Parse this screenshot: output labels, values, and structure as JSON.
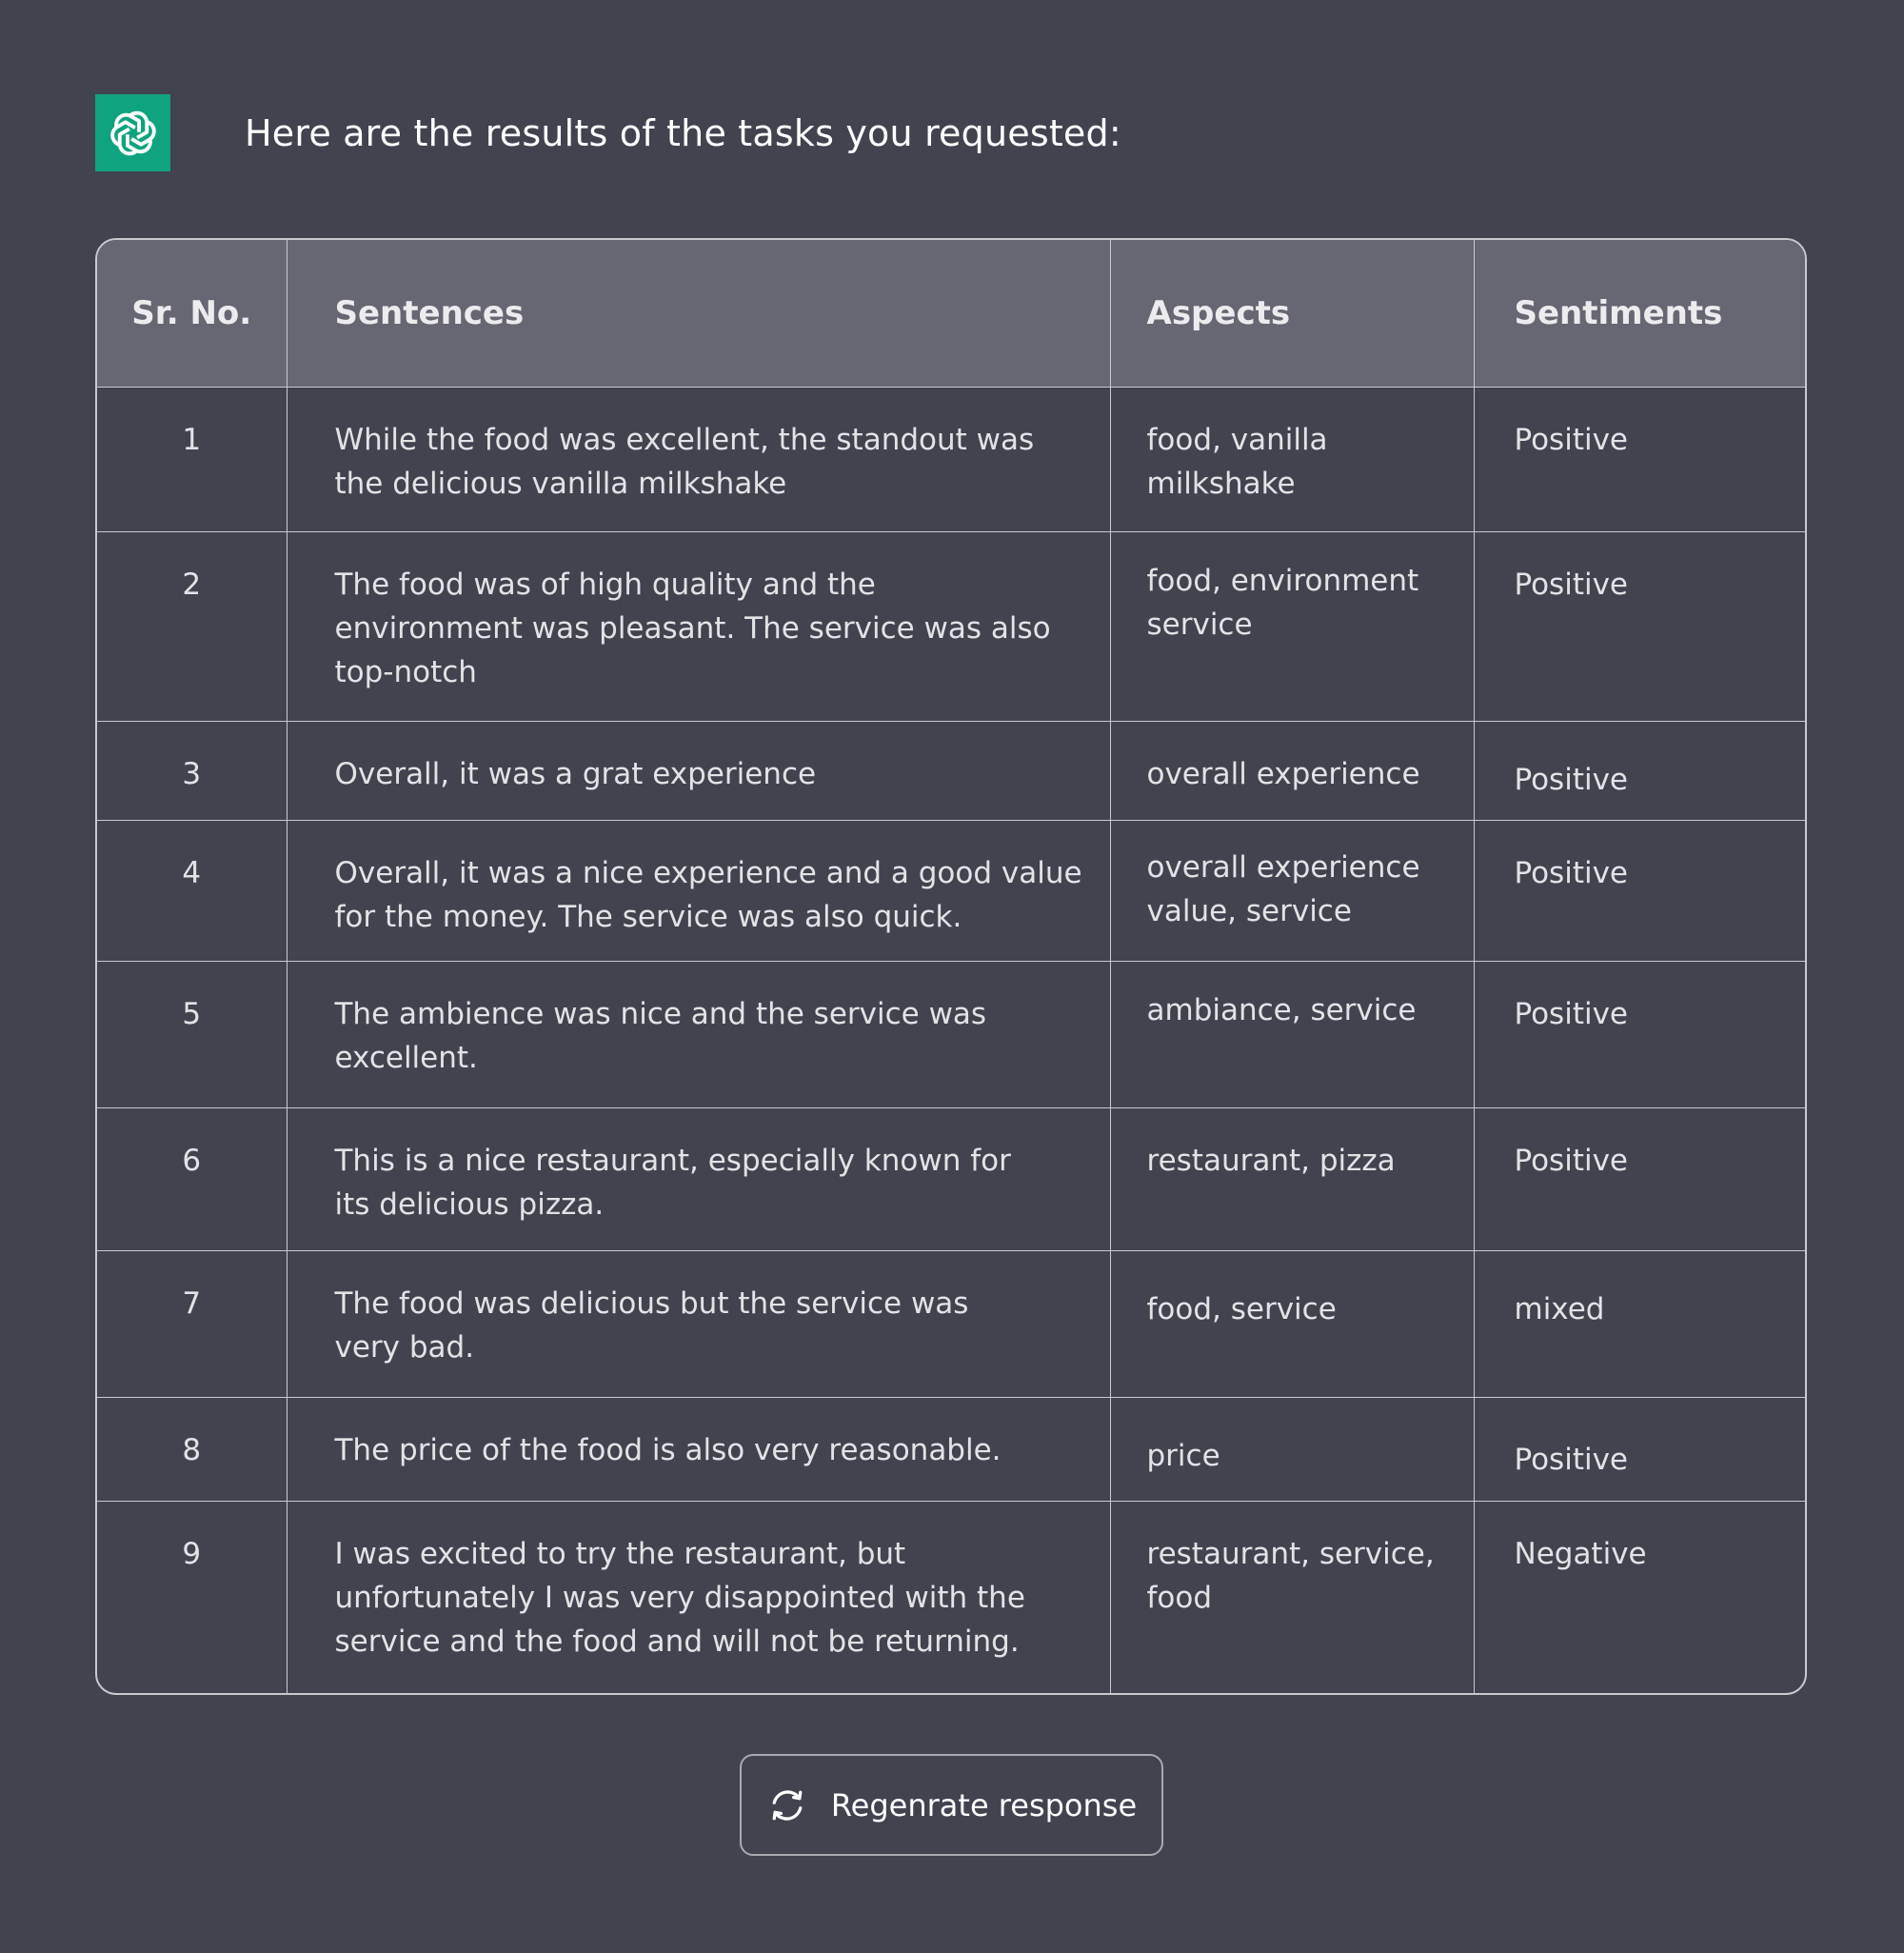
{
  "header": {
    "logo_icon": "openai-logo-icon",
    "title": "Here are the results of the tasks you requested:"
  },
  "colors": {
    "background": "#41434f",
    "header_row": "#676773",
    "logo_bg": "#10a37f",
    "border": "#c9c9ce"
  },
  "table": {
    "columns": [
      "Sr. No.",
      "Sentences",
      "Aspects",
      "Sentiments"
    ],
    "rows": [
      {
        "num": "1",
        "sentence": "While the food was excellent, the standout was the delicious vanilla milkshake",
        "aspects": "food, vanilla milkshake",
        "sentiment": "Positive"
      },
      {
        "num": "2",
        "sentence": "The food was of high quality and the environment was pleasant. The service was also top-notch",
        "aspects": "food, environment service",
        "sentiment": "Positive"
      },
      {
        "num": "3",
        "sentence": "Overall, it was a grat experience",
        "aspects": "overall experience",
        "sentiment": "Positive"
      },
      {
        "num": "4",
        "sentence": "Overall, it was a nice experience and a good value for the money. The service was also quick.",
        "aspects": "overall experience value, service",
        "sentiment": "Positive"
      },
      {
        "num": "5",
        "sentence": "The ambience was nice and the service was excellent.",
        "aspects": "ambiance, service",
        "sentiment": "Positive"
      },
      {
        "num": "6",
        "sentence": "This is a nice restaurant, especially known for its delicious pizza.",
        "aspects": "restaurant, pizza",
        "sentiment": "Positive"
      },
      {
        "num": "7",
        "sentence": "The food was delicious but the service was very bad.",
        "aspects": "food, service",
        "sentiment": "mixed"
      },
      {
        "num": "8",
        "sentence": "The price of the food is also very reasonable.",
        "aspects": "price",
        "sentiment": "Positive"
      },
      {
        "num": "9",
        "sentence": "I was excited to try the restaurant, but unfortunately I was very disappointed with the service and the food and will not be returning.",
        "aspects": "restaurant, service, food",
        "sentiment": "Negative"
      }
    ]
  },
  "regenerate_button": {
    "icon": "refresh-icon",
    "label": "Regenrate response"
  }
}
